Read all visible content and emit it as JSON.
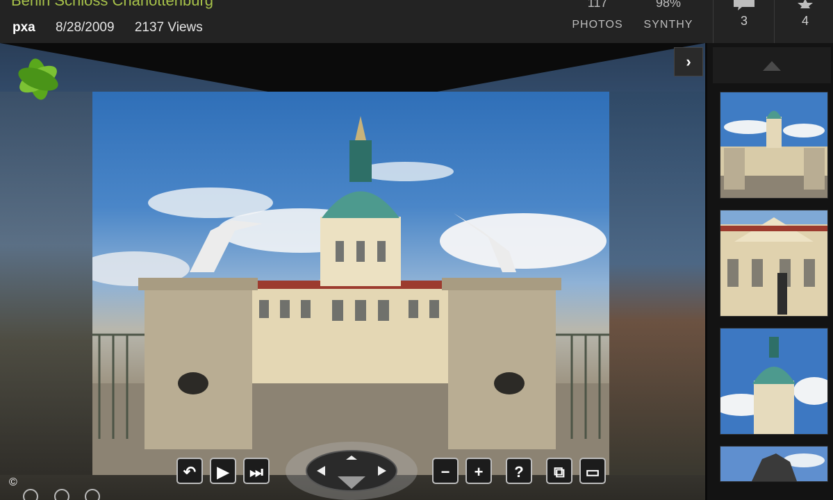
{
  "header": {
    "title": "Berlin Schloss Charlottenburg",
    "user": "pxa",
    "date": "8/28/2009",
    "views": "2137 Views",
    "photos_count": "117",
    "photos_label": "PHOTOS",
    "synthy_value": "98%",
    "synthy_label": "SYNTHY",
    "comments_count": "3",
    "favorites_count": "4"
  },
  "viewer": {
    "next_icon": "chevron-right-icon",
    "copyright": "©",
    "toolbar": [
      "undo-icon",
      "play-icon",
      "skip-next-icon",
      "minus-icon",
      "plus-icon",
      "help-icon",
      "overlay-icon",
      "window-icon"
    ],
    "toolbar_glyphs": {
      "minus": "−",
      "plus": "+",
      "help": "?"
    }
  },
  "sidebar": {
    "thumbnails": [
      "Schloss front with dome and statues",
      "Palace facade with equestrian statue",
      "Dome tower close-up",
      "Equestrian statue"
    ]
  },
  "colors": {
    "title": "#a7c24a",
    "header_bg": "#232323",
    "sidebar_bg": "#131313"
  }
}
